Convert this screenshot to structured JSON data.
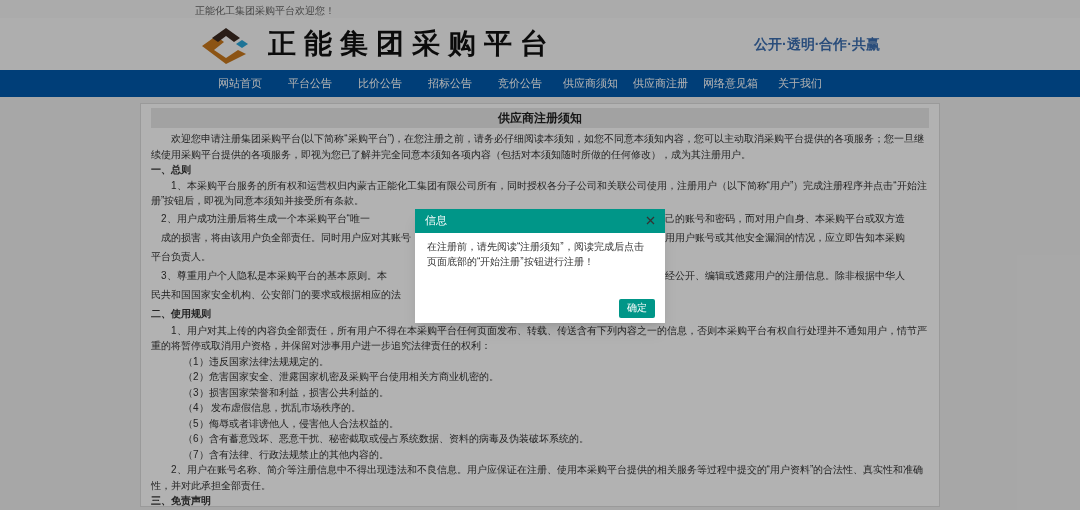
{
  "top_bar": {
    "welcome": "正能化工集团采购平台欢迎您！"
  },
  "header": {
    "title": "正能集团采购平台",
    "slogan": "公开·透明·合作·共赢"
  },
  "nav": {
    "items": [
      {
        "label": "网站首页"
      },
      {
        "label": "平台公告"
      },
      {
        "label": "比价公告"
      },
      {
        "label": "招标公告"
      },
      {
        "label": "竞价公告"
      },
      {
        "label": "供应商须知"
      },
      {
        "label": "供应商注册"
      },
      {
        "label": "网络意见箱"
      },
      {
        "label": "关于我们"
      }
    ]
  },
  "notice": {
    "title": "供应商注册须知",
    "blocks": [
      {
        "kind": "para",
        "text": "欢迎您申请注册集团采购平台(以下简称“采购平台”)，在您注册之前，请务必仔细阅读本须知，如您不同意本须知内容，您可以主动取消采购平台提供的各项服务；您一旦继续使用采购平台提供的各项服务，即视为您已了解并完全同意本须知各项内容（包括对本须知随时所做的任何修改），成为其注册用户。"
      },
      {
        "kind": "heading",
        "text": "一、总则"
      },
      {
        "kind": "para",
        "text": "1、本采购平台服务的所有权和运营权归内蒙古正能化工集团有限公司所有，同时授权各分子公司和关联公司使用，注册用户（以下简称“用户”）完成注册程序并点击“开始注册”按钮后，即视为同意本须知并接受所有条款。"
      },
      {
        "kind": "under_dialog",
        "rows": [
          {
            "kind": "split",
            "left": "2、用户成功注册后将生成一个本采购平台“唯一",
            "right": "己的账号和密码，而对用户自身、本采购平台或双方造"
          },
          {
            "kind": "split",
            "left": "成的损害，将由该用户负全部责任。同时用户应对其账号",
            "right": "用用户账号或其他安全漏洞的情况，应立即告知本采购"
          },
          {
            "kind": "line",
            "text": "平台负责人。"
          },
          {
            "kind": "split",
            "left": "3、尊重用户个人隐私是本采购平台的基本原则。本",
            "right": "经公开、编辑或透露用户的注册信息。除非根据中华人"
          },
          {
            "kind": "line",
            "text": "民共和国国家安全机构、公安部门的要求或根据相应的法"
          },
          {
            "kind": "heading",
            "text": "二、使用规则"
          }
        ]
      },
      {
        "kind": "para",
        "text": "1、用户对其上传的内容负全部责任，所有用户不得在本采购平台任何页面发布、转载、传送含有下列内容之一的信息，否则本采购平台有权自行处理并不通知用户，情节严重的将暂停或取消用户资格，并保留对涉事用户进一步追究法律责任的权利："
      },
      {
        "kind": "item",
        "text": "（1）违反国家法律法规规定的。"
      },
      {
        "kind": "item",
        "text": "（2）危害国家安全、泄露国家机密及采购平台使用相关方商业机密的。"
      },
      {
        "kind": "item",
        "text": "（3）损害国家荣誉和利益，损害公共利益的。"
      },
      {
        "kind": "item",
        "text": "（4） 发布虚假信息，扰乱市场秩序的。"
      },
      {
        "kind": "item",
        "text": "（5）侮辱或者诽谤他人，侵害他人合法权益的。"
      },
      {
        "kind": "item",
        "text": "（6）含有蓄意毁坏、恶意干扰、秘密截取或侵占系统数据、资料的病毒及伪装破坏系统的。"
      },
      {
        "kind": "item",
        "text": "（7）含有法律、行政法规禁止的其他内容的。"
      },
      {
        "kind": "para",
        "text": "2、用户在账号名称、简介等注册信息中不得出现违法和不良信息。用户应保证在注册、使用本采购平台提供的相关服务等过程中提交的“用户资料”的合法性、真实性和准确性，并对此承担全部责任。"
      },
      {
        "kind": "heading",
        "text": "三、免责声明"
      }
    ]
  },
  "dialog": {
    "title": "信息",
    "message": "在注册前，请先阅读“注册须知”，阅读完成后点击页面底部的“开始注册”按钮进行注册！",
    "button": "确定"
  }
}
